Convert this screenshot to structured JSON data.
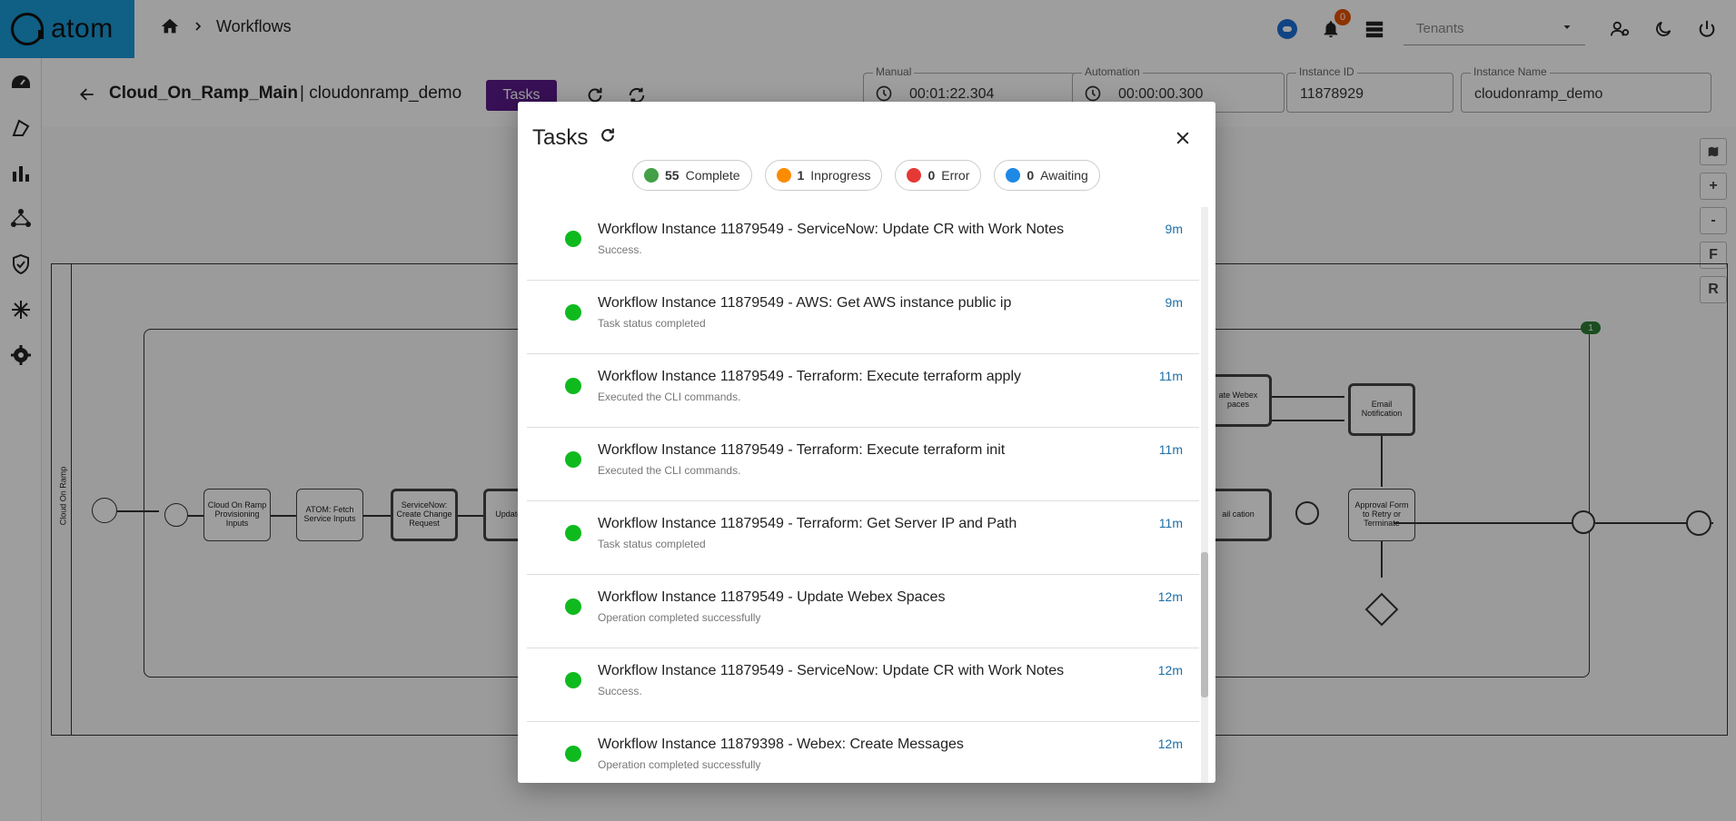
{
  "app": {
    "brand": "atom"
  },
  "breadcrumb": {
    "title": "Workflows"
  },
  "topbar": {
    "notifications_count": "0",
    "tenants_placeholder": "Tenants"
  },
  "workflow": {
    "name": "Cloud_On_Ramp_Main",
    "instance_name": "| cloudonramp_demo",
    "tasks_button": "Tasks",
    "fields": {
      "manual_label": "Manual",
      "manual_value": "00:01:22.304",
      "automation_label": "Automation",
      "automation_value": "00:00:00.300",
      "instance_id_label": "Instance ID",
      "instance_id_value": "11878929",
      "instance_name_label": "Instance Name",
      "instance_name_value": "cloudonramp_demo"
    }
  },
  "diagram": {
    "lane_label": "Cloud On Ramp",
    "tasks": {
      "provisioning_inputs": "Cloud On Ramp Provisioning Inputs",
      "fetch_inputs": "ATOM: Fetch Service Inputs",
      "create_change": "ServiceNow: Create Change Request",
      "update_spaces_left": "Update Spa",
      "update_webex_right": "ate Webex paces",
      "email_notification": "Email Notification",
      "email_notification_2": "ail cation",
      "approval_form": "Approval Form to Retry or Terminate"
    },
    "badge": "1",
    "zoom_controls": [
      "+",
      "-",
      "F",
      "R"
    ]
  },
  "modal": {
    "title": "Tasks",
    "chips": [
      {
        "count": "55",
        "label": "Complete",
        "color": "#43a047"
      },
      {
        "count": "1",
        "label": "Inprogress",
        "color": "#fb8c00"
      },
      {
        "count": "0",
        "label": "Error",
        "color": "#e53935"
      },
      {
        "count": "0",
        "label": "Awaiting",
        "color": "#1e88e5"
      }
    ],
    "tasks": [
      {
        "title": "Workflow Instance 11879549 - ServiceNow: Update CR with Work Notes",
        "status": "Success.",
        "time": "9m"
      },
      {
        "title": "Workflow Instance 11879549 - AWS: Get AWS instance public ip",
        "status": "Task status completed",
        "time": "9m"
      },
      {
        "title": "Workflow Instance 11879549 - Terraform: Execute terraform apply",
        "status": "Executed the CLI commands.",
        "time": "11m"
      },
      {
        "title": "Workflow Instance 11879549 - Terraform: Execute terraform init",
        "status": "Executed the CLI commands.",
        "time": "11m"
      },
      {
        "title": "Workflow Instance 11879549 - Terraform: Get Server IP and Path",
        "status": "Task status completed",
        "time": "11m"
      },
      {
        "title": "Workflow Instance 11879549 - Update Webex Spaces",
        "status": "Operation completed successfully",
        "time": "12m"
      },
      {
        "title": "Workflow Instance 11879549 - ServiceNow: Update CR with Work Notes",
        "status": "Success.",
        "time": "12m"
      },
      {
        "title": "Workflow Instance 11879398 - Webex: Create Messages",
        "status": "Operation completed successfully",
        "time": "12m"
      }
    ]
  }
}
